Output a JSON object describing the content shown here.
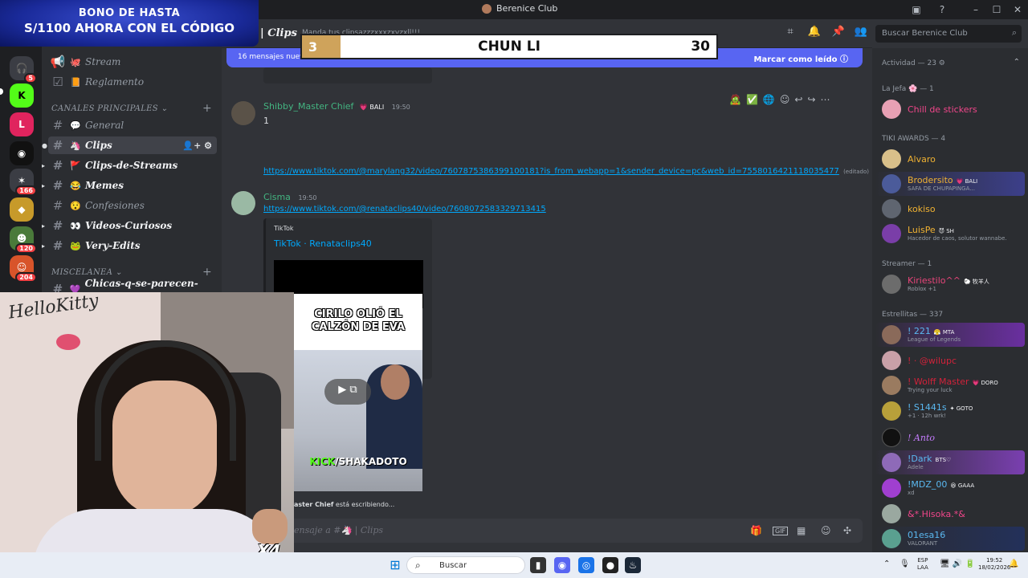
{
  "window": {
    "title": "Berenice Club"
  },
  "promo": {
    "line1": "BONO DE HASTA",
    "line2": "S/1100 AHORA CON EL CÓDIGO"
  },
  "server_badges": [
    "5",
    "166",
    "120",
    "204"
  ],
  "channels": {
    "top": [
      {
        "emoji": "🐙",
        "label": "Stream",
        "type": "announce"
      },
      {
        "emoji": "📙",
        "label": "Reglamento",
        "type": "rules"
      }
    ],
    "category_main": "CANALES PRINCIPALES",
    "main": [
      {
        "emoji": "💬",
        "label": "General",
        "state": "normal"
      },
      {
        "emoji": "🦄",
        "label": "Clips",
        "state": "active"
      },
      {
        "emoji": "🚩",
        "label": "Clips-de-Streams",
        "state": "unread"
      },
      {
        "emoji": "😂",
        "label": "Memes",
        "state": "unread"
      },
      {
        "emoji": "😯",
        "label": "Confesiones",
        "state": "normal"
      },
      {
        "emoji": "👀",
        "label": "Videos-Curiosos",
        "state": "unread"
      },
      {
        "emoji": "🐸",
        "label": "Very-Edits",
        "state": "unread"
      }
    ],
    "category_misc": "MISCELANEA",
    "misc": [
      {
        "emoji": "💜",
        "label": "Chicas-q-se-parecen-a-...",
        "state": "unread"
      }
    ]
  },
  "header": {
    "channel": "Clips",
    "topic": "Manda tus clipsazzzxxxzxvzxll!!!",
    "search_placeholder": "Buscar Berenice Club"
  },
  "scoreboard": {
    "left_score": "3",
    "name": "CHUN LI",
    "right_score": "30"
  },
  "new_messages": {
    "text": "16 mensajes nuevos desde las 1:39",
    "mark_label": "Marcar como leído"
  },
  "messages": [
    {
      "author": "Shibby_Master Chief",
      "tag": "💗 BALI",
      "time": "19:50",
      "text": "1",
      "link": "https://www.tiktok.com/@marylang32/video/7607875386399100181?is_from_webapp=1&sender_device=pc&web_id=7558016421118035477",
      "edited": "(editado)"
    },
    {
      "author": "Cisma",
      "time": "19:50",
      "link": "https://www.tiktok.com/@renataclips40/video/7608072583329713415",
      "embed": {
        "provider": "TikTok",
        "title": "TikTok · Renataclips40"
      }
    }
  ],
  "video": {
    "caption": "CIRILO OLIÓ EL CALZÓN DE EVA",
    "footer_prefix": "KICK",
    "footer_suffix": "/SHAKADOTO"
  },
  "typing": {
    "who": "aster Chief",
    "rest": "está escribiendo..."
  },
  "composer": {
    "placeholder_prefix": "ensaje a #",
    "placeholder_channel": "Clips"
  },
  "webcam": {
    "wall_text": "HelloKitty",
    "overlay_badge": "X4"
  },
  "members": {
    "activity": "Actividad — 23",
    "groups": [
      {
        "title": "La Jefa 🌸 — 1",
        "items": [
          {
            "name": "Chill de stickers",
            "color": "#f0468a",
            "status": ""
          }
        ]
      },
      {
        "title": "TIKI AWARDS — 4",
        "items": [
          {
            "name": "Alvaro",
            "color": "#f0b232",
            "status": ""
          },
          {
            "name": "Brodersito",
            "tag": "💗 BALI",
            "color": "#f0b232",
            "status": "SAFA DE CHUPAPINGA..."
          },
          {
            "name": "kokiso",
            "color": "#f0b232",
            "status": ""
          },
          {
            "name": "LuisPe",
            "tag": "😈 SH",
            "color": "#f0b232",
            "status": "Hacedor de caos, solutor wannabe."
          }
        ]
      },
      {
        "title": "Streamer — 1",
        "items": [
          {
            "name": "Kiriestilo^^",
            "tag": "🐑 牧羊人",
            "color": "#e8457a",
            "status": "Roblox +1"
          }
        ]
      },
      {
        "title": "Estrellitas — 337",
        "items": [
          {
            "name": "! 221",
            "tag": "😤 MTA",
            "color": "#5ab8f0",
            "status": "League of Legends"
          },
          {
            "name": "! · @wilupc",
            "color": "#d1223a",
            "status": ""
          },
          {
            "name": "! Wolff Master",
            "tag": "💗 DORO",
            "color": "#d1223a",
            "status": "Trying your luck"
          },
          {
            "name": "! S1441s",
            "tag": "✦ GOTO",
            "color": "#5ab8f0",
            "status": "+1 · 12h wrk!"
          },
          {
            "name": "! Anto",
            "color": "#c77dff",
            "status": ""
          },
          {
            "name": "!Dark",
            "tag": "BTS♡",
            "color": "#5ab8f0",
            "status": "Adele"
          },
          {
            "name": "!MDZ_00",
            "tag": "😆 GAAA",
            "color": "#5ab8f0",
            "status": "xd"
          },
          {
            "name": "&*.Hisoka.*&",
            "color": "#f0468a",
            "status": ""
          },
          {
            "name": "01esa16",
            "color": "#5ab8f0",
            "status": "VALORANT"
          }
        ]
      }
    ]
  },
  "taskbar": {
    "search": "Buscar",
    "lang_top": "ESP",
    "lang_bottom": "LAA",
    "time": "19:52",
    "date": "18/02/2026"
  },
  "colors": {
    "accent": "#5865f2",
    "link": "#00a8fc",
    "online": "#23a55a"
  }
}
